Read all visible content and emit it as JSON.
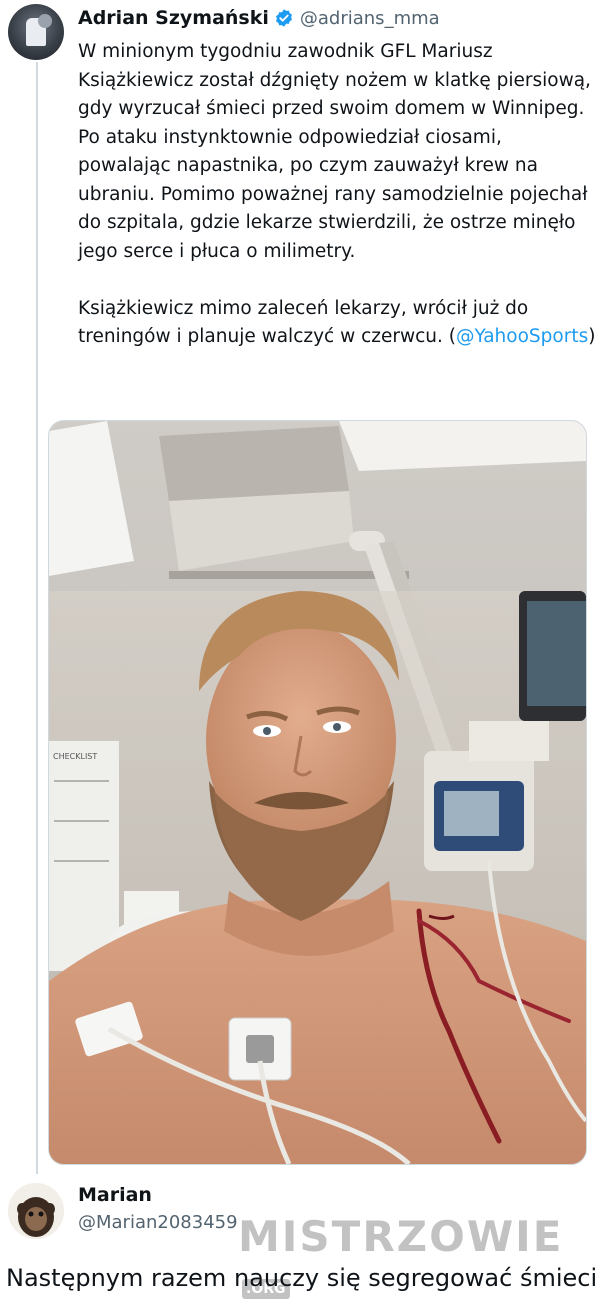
{
  "tweet": {
    "author_name": "Adrian Szymański",
    "author_handle": "@adrians_mma",
    "paragraph1": "W minionym tygodniu zawodnik GFL Mariusz Książkiewicz został dźgnięty nożem w klatkę piersiową, gdy wyrzucał śmieci przed swoim domem w Winnipeg. Po ataku instynktownie odpowiedział ciosami, powalając napastnika, po czym zauważył krew na ubraniu. Pomimo poważnej rany samodzielnie pojechał do szpitala, gdzie lekarze stwierdzili, że ostrze minęło jego serce i płuca o milimetry.",
    "paragraph2_text": "Książkiewicz mimo zaleceń lekarzy, wrócił już do treningów i planuje walczyć w czerwcu. (",
    "paragraph2_mention": "@YahooSports",
    "paragraph2_close": ")",
    "verified_color": "#1d9bf0",
    "mention_color": "#1d9bf0",
    "photo_wall_sign": "CHECKLIST"
  },
  "reply": {
    "author_name": "Marian",
    "author_handle": "@Marian2083459"
  },
  "watermark": {
    "text": "MISTRZOWIE",
    "suffix": ".ORG"
  },
  "caption": "Następnym razem nauczy się segregować śmieci"
}
